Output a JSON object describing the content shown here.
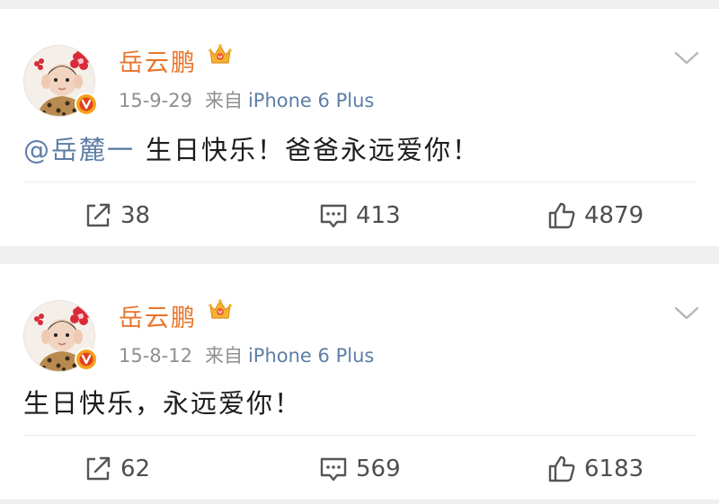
{
  "posts": [
    {
      "username": "岳云鹏",
      "date": "15-9-29",
      "source_prefix": "来自",
      "device": "iPhone 6 Plus",
      "mention": "@岳麓一",
      "text": "生日快乐！爸爸永远爱你！",
      "reposts": "38",
      "comments": "413",
      "likes": "4879"
    },
    {
      "username": "岳云鹏",
      "date": "15-8-12",
      "source_prefix": "来自",
      "device": "iPhone 6 Plus",
      "mention": "",
      "text": "生日快乐，永远爱你！",
      "reposts": "62",
      "comments": "569",
      "likes": "6183"
    }
  ],
  "icons": {
    "verified": "verified-badge-icon",
    "crown": "vip-crown-icon",
    "chevron": "chevron-down-icon",
    "repost": "repost-icon",
    "comment": "comment-icon",
    "like": "like-icon"
  },
  "colors": {
    "username": "#e8742a",
    "link": "#5d7ea6",
    "meta": "#8f8f8f",
    "background": "#efefef",
    "verified": "#f7a21b"
  }
}
